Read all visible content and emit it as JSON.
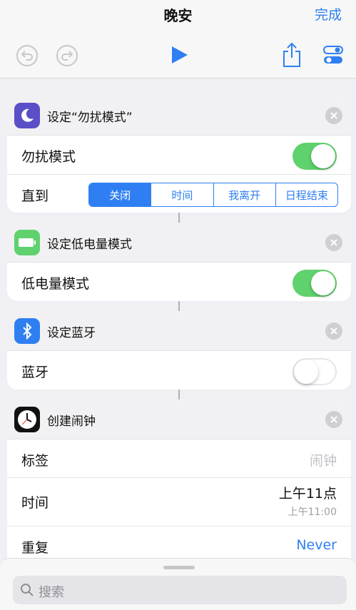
{
  "nav": {
    "title": "晚安",
    "done_label": "完成"
  },
  "colors": {
    "accent": "#2f7ff2",
    "toggle_on": "#5fd16d",
    "dnd_icon_bg": "#5b4fc7",
    "battery_icon_bg": "#5fd16d",
    "bluetooth_icon_bg": "#2f7ff2"
  },
  "toolbar": {
    "icons": [
      "undo-icon",
      "redo-icon",
      "play-icon",
      "share-icon",
      "settings-toggle-icon"
    ]
  },
  "cards": {
    "dnd": {
      "title": "设定“勿扰模式”",
      "toggle_label": "勿扰模式",
      "toggle_on": true,
      "until_label": "直到",
      "segments": [
        "关闭",
        "时间",
        "我离开",
        "日程结束"
      ],
      "selected_segment": "关闭"
    },
    "low_power": {
      "title": "设定低电量模式",
      "toggle_label": "低电量模式",
      "toggle_on": true
    },
    "bluetooth": {
      "title": "设定蓝牙",
      "toggle_label": "蓝牙",
      "toggle_on": false
    },
    "alarm": {
      "title": "创建闹钟",
      "label_label": "标签",
      "label_placeholder": "闹钟",
      "time_label": "时间",
      "time_value": "上午11点",
      "time_sub": "上午11:00",
      "repeat_label": "重复",
      "repeat_value": "Never"
    }
  },
  "search": {
    "placeholder": "搜索"
  }
}
